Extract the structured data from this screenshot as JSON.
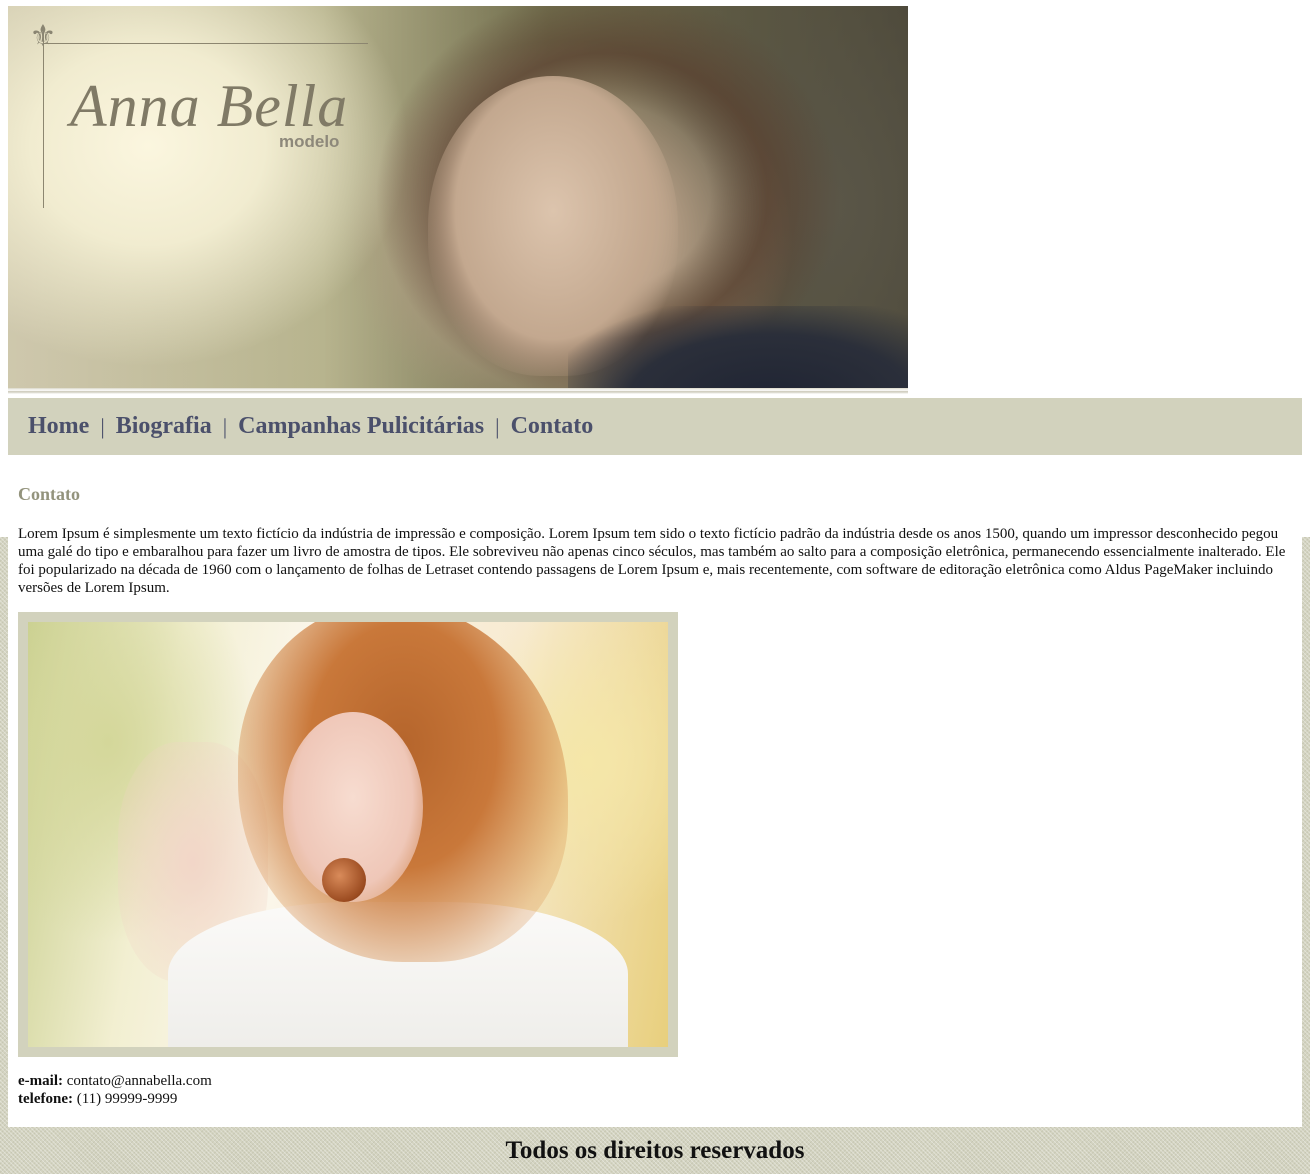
{
  "header": {
    "logo_name": "Anna Bella",
    "logo_sub": "modelo",
    "logo_icon": "fleur-de-lis-icon"
  },
  "nav": {
    "items": [
      {
        "label": "Home"
      },
      {
        "label": "Biografia"
      },
      {
        "label": "Campanhas Pulicitárias"
      },
      {
        "label": "Contato"
      }
    ],
    "separator": "|"
  },
  "main": {
    "title": "Contato",
    "paragraph": "Lorem Ipsum é simplesmente um texto fictício da indústria de impressão e composição. Lorem Ipsum tem sido o texto fictício padrão da indústria desde os anos 1500, quando um impressor desconhecido pegou uma galé do tipo e embaralhou para fazer um livro de amostra de tipos. Ele sobreviveu não apenas cinco séculos, mas também ao salto para a composição eletrônica, permanecendo essencialmente inalterado. Ele foi popularizado na década de 1960 com o lançamento de folhas de Letraset contendo passagens de Lorem Ipsum e, mais recentemente, com software de editoração eletrônica como Aldus PageMaker incluindo versões de Lorem Ipsum.",
    "contact": {
      "email_label": "e-mail:",
      "email_value": "contato@annabella.com",
      "phone_label": "telefone:",
      "phone_value": "(11) 99999-9999"
    }
  },
  "footer": {
    "text": "Todos os direitos reservados"
  },
  "colors": {
    "nav_bg": "#d2d2bd",
    "nav_link": "#4b506b",
    "title": "#93937c",
    "page_texture": "#d3d3c0"
  }
}
